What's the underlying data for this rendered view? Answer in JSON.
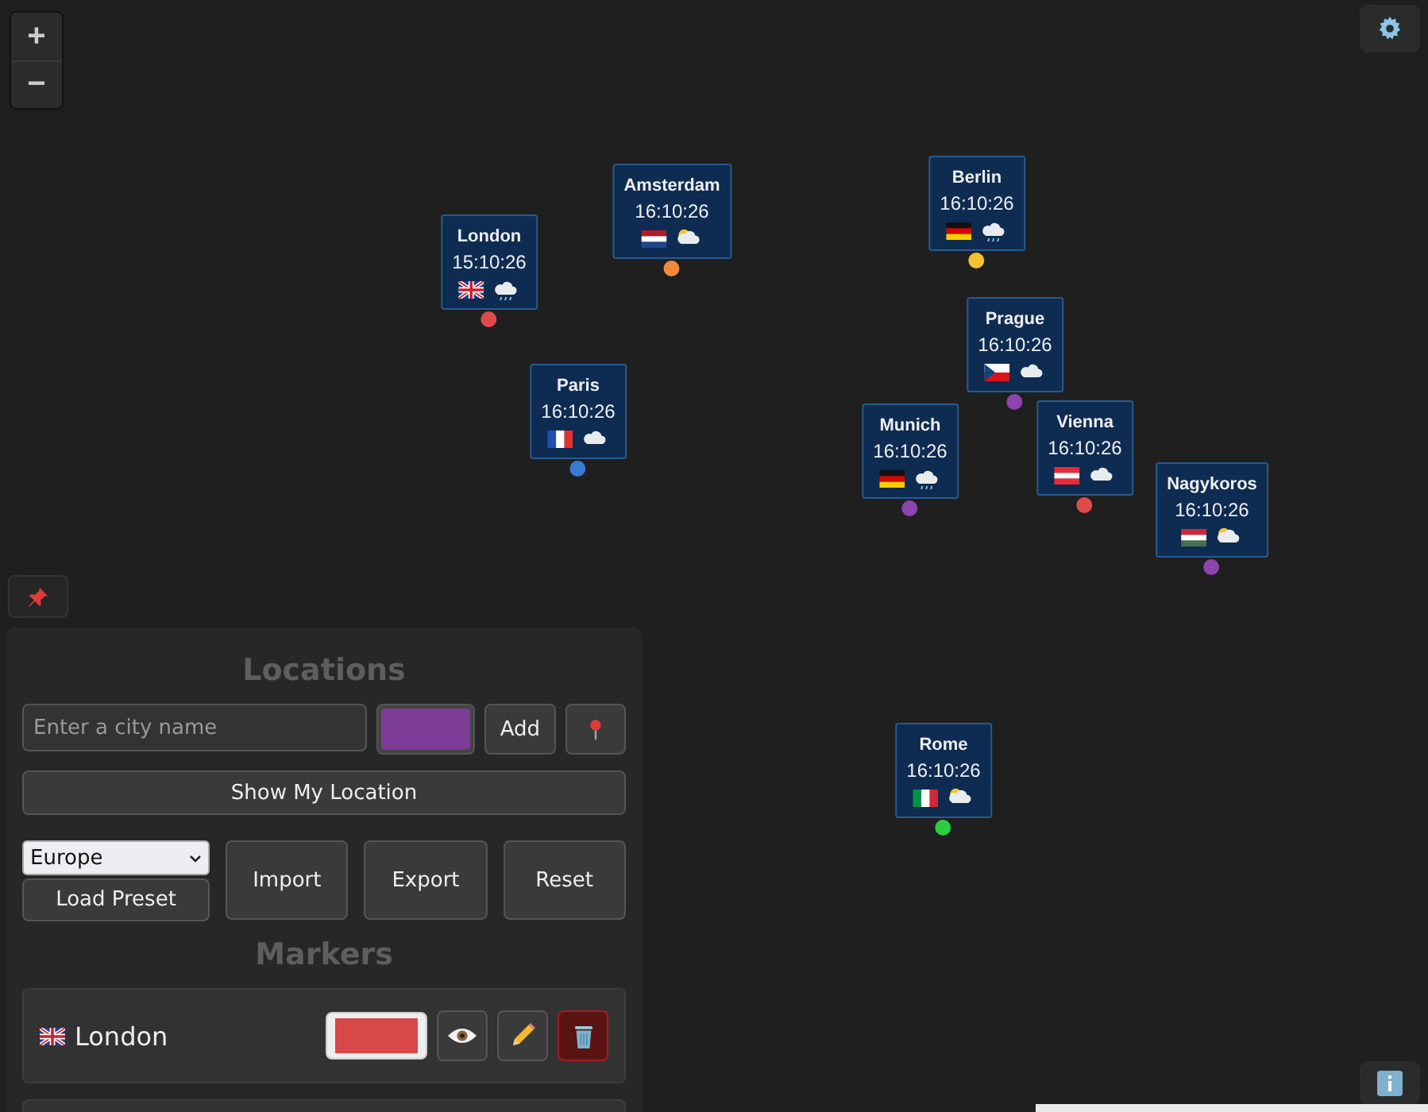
{
  "zoom_controls": [
    {
      "label": "+"
    },
    {
      "label": "−"
    }
  ],
  "markers": [
    {
      "name": "London",
      "time": "15:10:26",
      "flag": {
        "kind": "gb"
      },
      "weather": {
        "kind": "rain"
      },
      "color": "#e04a4a"
    },
    {
      "name": "Amsterdam",
      "time": "16:10:26",
      "flag": {
        "kind": "nl"
      },
      "weather": {
        "kind": "partly-sunny"
      },
      "color": "#f0883e"
    },
    {
      "name": "Berlin",
      "time": "16:10:26",
      "flag": {
        "kind": "de"
      },
      "weather": {
        "kind": "rain"
      },
      "color": "#f2c230"
    },
    {
      "name": "Paris",
      "time": "16:10:26",
      "flag": {
        "kind": "fr"
      },
      "weather": {
        "kind": "cloud"
      },
      "color": "#3a7bd5"
    },
    {
      "name": "Prague",
      "time": "16:10:26",
      "flag": {
        "kind": "cz"
      },
      "weather": {
        "kind": "cloud"
      },
      "color": "#8e44ad"
    },
    {
      "name": "Munich",
      "time": "16:10:26",
      "flag": {
        "kind": "de"
      },
      "weather": {
        "kind": "rain"
      },
      "color": "#8e44ad"
    },
    {
      "name": "Vienna",
      "time": "16:10:26",
      "flag": {
        "kind": "at"
      },
      "weather": {
        "kind": "cloud"
      },
      "color": "#e04a4a"
    },
    {
      "name": "Nagykoros",
      "time": "16:10:26",
      "flag": {
        "kind": "hu"
      },
      "weather": {
        "kind": "partly-sunny"
      },
      "color": "#8e44ad"
    },
    {
      "name": "Rome",
      "time": "16:10:26",
      "flag": {
        "kind": "it"
      },
      "weather": {
        "kind": "partly-sunny"
      },
      "color": "#2ecc40"
    }
  ],
  "panel": {
    "title": "Locations",
    "city_input": {
      "placeholder": "Enter a city name"
    },
    "color_picker": {
      "color": "#7d3c98"
    },
    "add_button": "Add",
    "show_location_button": "Show My Location",
    "preset_select": {
      "value": "Europe"
    },
    "load_preset_button": "Load Preset",
    "import_button": "Import",
    "export_button": "Export",
    "reset_button": "Reset",
    "markers_title": "Markers",
    "marker_rows": [
      {
        "flag": {
          "kind": "gb"
        },
        "name": "London",
        "color": "#d94848"
      }
    ]
  }
}
